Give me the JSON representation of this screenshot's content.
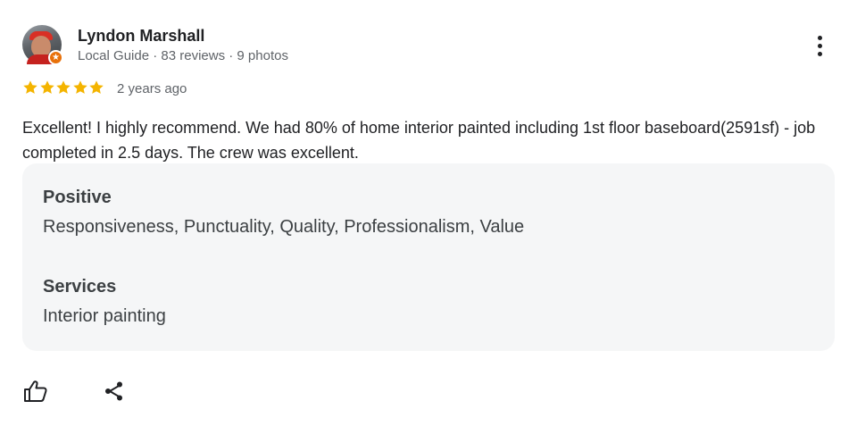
{
  "author": {
    "name": "Lyndon Marshall",
    "meta": "Local Guide · 83 reviews · 9 photos"
  },
  "rating": {
    "stars": 5,
    "max": 5,
    "star_color": "#f4b400",
    "date": "2 years ago"
  },
  "review": {
    "text": "Excellent! I highly recommend. We had 80% of home interior painted including 1st floor baseboard(2591sf) - job completed in 2.5 days. The crew was excellent."
  },
  "attributes": [
    {
      "heading": "Positive",
      "value": "Responsiveness, Punctuality, Quality, Professionalism, Value"
    },
    {
      "heading": "Services",
      "value": "Interior painting"
    }
  ],
  "actions": {
    "like_icon": "thumbs-up-icon",
    "share_icon": "share-icon",
    "more_icon": "more-vertical-icon"
  },
  "colors": {
    "text_primary": "#202124",
    "text_secondary": "#5f6368",
    "panel_background": "#f5f6f7",
    "local_guide_badge": "#e8710a"
  }
}
